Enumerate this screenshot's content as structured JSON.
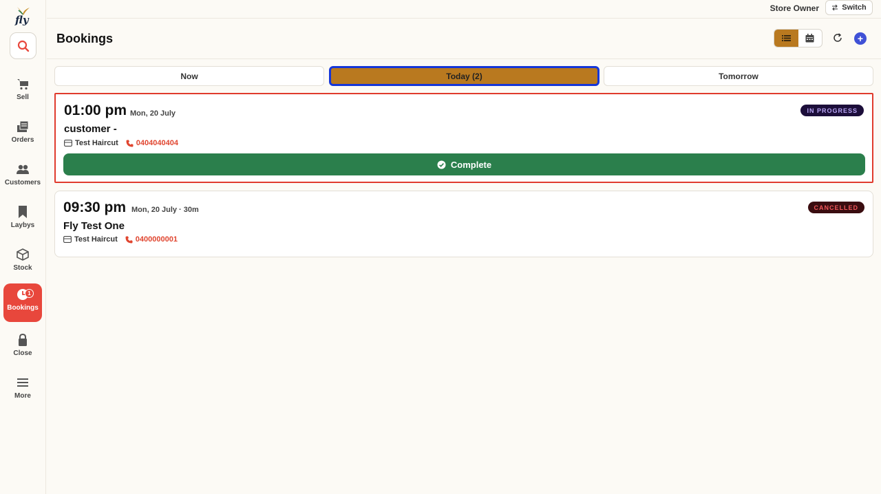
{
  "app": {
    "logo_text": "fly"
  },
  "topbar": {
    "user_label": "Store Owner",
    "switch_label": "Switch"
  },
  "sidebar": {
    "items": [
      {
        "label": "Sell",
        "icon": "cart-icon"
      },
      {
        "label": "Orders",
        "icon": "orders-icon"
      },
      {
        "label": "Customers",
        "icon": "customers-icon"
      },
      {
        "label": "Laybys",
        "icon": "bookmark-icon"
      },
      {
        "label": "Stock",
        "icon": "box-icon"
      },
      {
        "label": "Bookings",
        "icon": "clock-icon",
        "badge": "1",
        "active": true
      },
      {
        "label": "Close",
        "icon": "lock-icon"
      },
      {
        "label": "More",
        "icon": "menu-icon"
      }
    ]
  },
  "header": {
    "title": "Bookings",
    "view_modes": [
      "list",
      "calendar"
    ],
    "active_view": "list"
  },
  "tabs": [
    {
      "label": "Now",
      "active": false
    },
    {
      "label": "Today (2)",
      "active": true
    },
    {
      "label": "Tomorrow",
      "active": false
    }
  ],
  "bookings": [
    {
      "time": "01:00 pm",
      "date": "Mon, 20 July",
      "customer": "customer -",
      "service": "Test Haircut",
      "phone": "0404040404",
      "status": "IN PROGRESS",
      "action_label": "Complete"
    },
    {
      "time": "09:30 pm",
      "date": "Mon, 20 July",
      "duration": "· 30m",
      "customer": "Fly Test One",
      "service": "Test Haircut",
      "phone": "0400000001",
      "status": "CANCELLED"
    }
  ],
  "colors": {
    "accent": "#b9791f",
    "active_nav": "#e8473c",
    "complete": "#2b7f4c",
    "add_button": "#3f51d6",
    "phone": "#e0452f"
  }
}
